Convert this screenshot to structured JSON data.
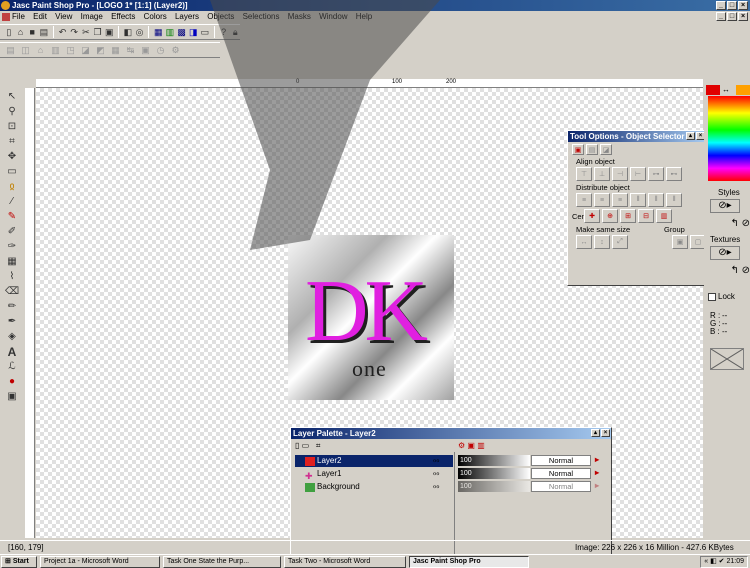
{
  "app": {
    "title": "Jasc Paint Shop Pro - [LOGO 1* [1:1] (Layer2)]"
  },
  "menu": [
    "File",
    "Edit",
    "View",
    "Image",
    "Effects",
    "Colors",
    "Layers",
    "Objects",
    "Selections",
    "Masks",
    "Window",
    "Help"
  ],
  "canvas": {
    "logo_main": "DK",
    "logo_sub": "one",
    "ruler_labels": [
      "0",
      "100",
      "200"
    ]
  },
  "tool_options": {
    "title": "Tool Options - Object Selector",
    "align_label": "Align object",
    "distribute_label": "Distribute object",
    "center_label": "Cen",
    "same_size_label": "Make same size",
    "group_label": "Group"
  },
  "right_panel": {
    "styles_label": "Styles",
    "textures_label": "Textures",
    "lock_label": "Lock",
    "r_label": "R :",
    "g_label": "G :",
    "b_label": "B :",
    "r_value": "--",
    "g_value": "--",
    "b_value": "--"
  },
  "layer_palette": {
    "title": "Layer Palette - Layer2",
    "layers": [
      {
        "name": "Layer2",
        "opacity": "100",
        "blend": "Normal",
        "selected": true
      },
      {
        "name": "Layer1",
        "opacity": "100",
        "blend": "Normal",
        "selected": false
      },
      {
        "name": "Background",
        "opacity": "100",
        "blend": "Normal",
        "selected": false
      }
    ]
  },
  "status": {
    "coords": "[160, 179]",
    "image_info": "Image: 226 x 226 x 16 Million - 427.6 KBytes"
  },
  "taskbar": {
    "start_label": "Start",
    "tasks": [
      "Project 1a - Microsoft Word",
      "Task One State the Purp...",
      "Task Two - Microsoft Word",
      "Jasc Paint Shop Pro"
    ],
    "clock": "21:09"
  },
  "colors": {
    "title_bar": "#0a246a",
    "logo_magenta": "#e020e0"
  }
}
